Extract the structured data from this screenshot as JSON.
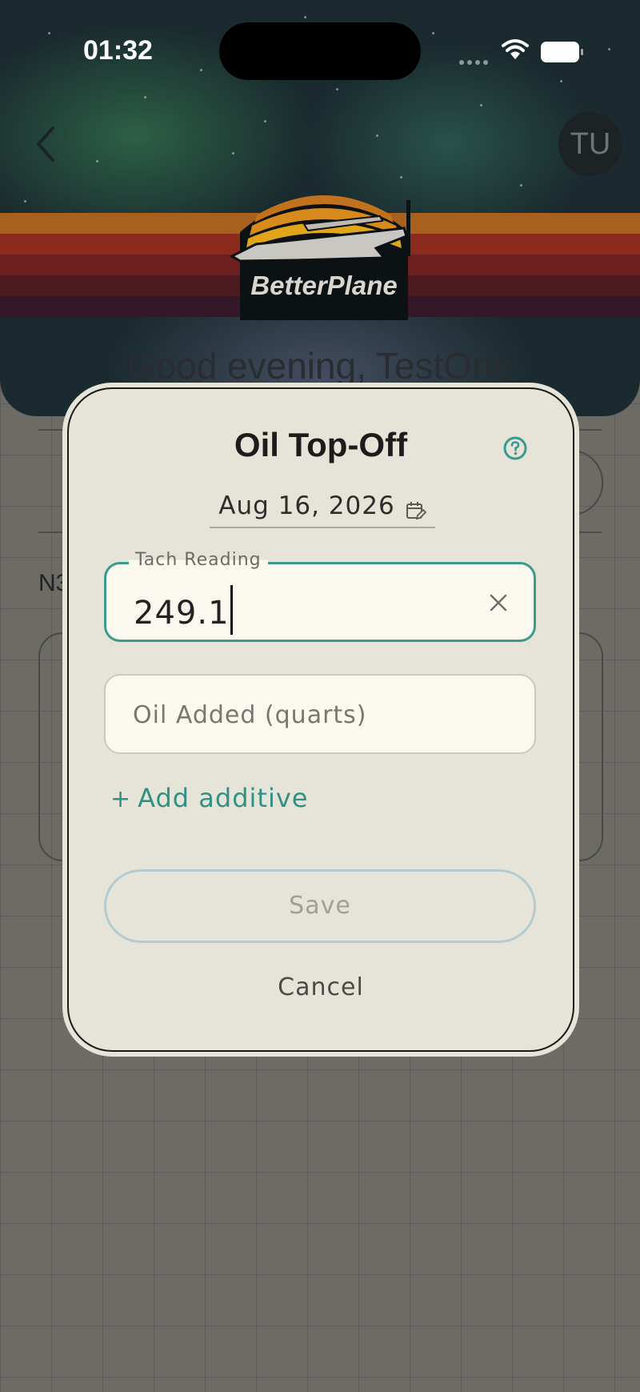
{
  "status_bar": {
    "time": "01:32"
  },
  "header": {
    "avatar_initials": "TU",
    "logo_text": "BetterPlane",
    "greeting": "Good evening, TestOne"
  },
  "background": {
    "partial_label": "N3"
  },
  "modal": {
    "title": "Oil Top-Off",
    "date": "Aug 16, 2026",
    "tach_field": {
      "label": "Tach Reading",
      "value": "249.1"
    },
    "oil_field": {
      "placeholder": "Oil Added (quarts)"
    },
    "add_additive_label": "Add additive",
    "save_label": "Save",
    "cancel_label": "Cancel"
  },
  "colors": {
    "accent": "#3a9a90",
    "modal_bg": "#e6e3d8",
    "field_bg": "#fbf9ef",
    "save_border": "#b3cbd3"
  },
  "icons": [
    "back-chevron-icon",
    "help-icon",
    "calendar-edit-icon",
    "clear-icon",
    "plus-icon",
    "wifi-icon",
    "battery-icon"
  ]
}
